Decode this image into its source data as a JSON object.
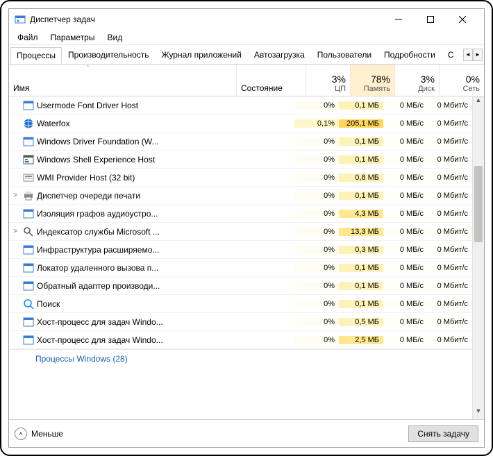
{
  "window": {
    "title": "Диспетчер задач"
  },
  "menus": {
    "file": "Файл",
    "options": "Параметры",
    "view": "Вид"
  },
  "tabs": {
    "processes": "Процессы",
    "performance": "Производительность",
    "apphistory": "Журнал приложений",
    "startup": "Автозагрузка",
    "users": "Пользователи",
    "details": "Подробности",
    "services_trunc": "С"
  },
  "columns": {
    "name": "Имя",
    "state": "Состояние",
    "cpu_pct": "3%",
    "cpu_label": "ЦП",
    "mem_pct": "78%",
    "mem_label": "Память",
    "disk_pct": "3%",
    "disk_label": "Диск",
    "net_pct": "0%",
    "net_label": "Сеть"
  },
  "rows": [
    {
      "icon": "window",
      "expand": "",
      "name": "Usermode Font Driver Host",
      "cpu": "0%",
      "mem": "0,1 МБ",
      "disk": "0 МБ/с",
      "net": "0 Мбит/с",
      "mcls": "mem-a",
      "ccls": "cpu0"
    },
    {
      "icon": "globe",
      "expand": "",
      "name": "Waterfox",
      "cpu": "0,1%",
      "mem": "205,1 МБ",
      "disk": "0 МБ/с",
      "net": "0 Мбит/с",
      "mcls": "mem-c",
      "ccls": "cpu1"
    },
    {
      "icon": "window",
      "expand": "",
      "name": "Windows Driver Foundation (W...",
      "cpu": "0%",
      "mem": "0,1 МБ",
      "disk": "0 МБ/с",
      "net": "0 Мбит/с",
      "mcls": "mem-a",
      "ccls": "cpu0"
    },
    {
      "icon": "shell",
      "expand": "",
      "name": "Windows Shell Experience Host",
      "cpu": "0%",
      "mem": "0,1 МБ",
      "disk": "0 МБ/с",
      "net": "0 Мбит/с",
      "mcls": "mem-a",
      "ccls": "cpu0"
    },
    {
      "icon": "wmi",
      "expand": "",
      "name": "WMI Provider Host (32 bit)",
      "cpu": "0%",
      "mem": "0,8 МБ",
      "disk": "0 МБ/с",
      "net": "0 Мбит/с",
      "mcls": "mem-a",
      "ccls": "cpu0"
    },
    {
      "icon": "printer",
      "expand": ">",
      "name": "Диспетчер очереди печати",
      "cpu": "0%",
      "mem": "0,1 МБ",
      "disk": "0 МБ/с",
      "net": "0 Мбит/с",
      "mcls": "mem-a",
      "ccls": "cpu0"
    },
    {
      "icon": "window",
      "expand": "",
      "name": "Изоляция графов аудиоустро...",
      "cpu": "0%",
      "mem": "4,3 МБ",
      "disk": "0 МБ/с",
      "net": "0 Мбит/с",
      "mcls": "mem-b",
      "ccls": "cpu0"
    },
    {
      "icon": "search",
      "expand": ">",
      "name": "Индексатор службы Microsoft ...",
      "cpu": "0%",
      "mem": "13,3 МБ",
      "disk": "0 МБ/с",
      "net": "0 Мбит/с",
      "mcls": "mem-b",
      "ccls": "cpu0"
    },
    {
      "icon": "window",
      "expand": "",
      "name": "Инфраструктура расширяемо...",
      "cpu": "0%",
      "mem": "0,3 МБ",
      "disk": "0 МБ/с",
      "net": "0 Мбит/с",
      "mcls": "mem-a",
      "ccls": "cpu0"
    },
    {
      "icon": "window",
      "expand": "",
      "name": "Локатор удаленного вызова п...",
      "cpu": "0%",
      "mem": "0,1 МБ",
      "disk": "0 МБ/с",
      "net": "0 Мбит/с",
      "mcls": "mem-a",
      "ccls": "cpu0"
    },
    {
      "icon": "window",
      "expand": "",
      "name": "Обратный адаптер производи...",
      "cpu": "0%",
      "mem": "0,1 МБ",
      "disk": "0 МБ/с",
      "net": "0 Мбит/с",
      "mcls": "mem-a",
      "ccls": "cpu0"
    },
    {
      "icon": "lens",
      "expand": "",
      "name": "Поиск",
      "cpu": "0%",
      "mem": "0,1 МБ",
      "disk": "0 МБ/с",
      "net": "0 Мбит/с",
      "mcls": "mem-a",
      "ccls": "cpu0"
    },
    {
      "icon": "window",
      "expand": "",
      "name": "Хост-процесс для задач Windo...",
      "cpu": "0%",
      "mem": "0,5 МБ",
      "disk": "0 МБ/с",
      "net": "0 Мбит/с",
      "mcls": "mem-a",
      "ccls": "cpu0"
    },
    {
      "icon": "window",
      "expand": "",
      "name": "Хост-процесс для задач Windo...",
      "cpu": "0%",
      "mem": "2,5 МБ",
      "disk": "0 МБ/с",
      "net": "0 Мбит/с",
      "mcls": "mem-b",
      "ccls": "cpu0"
    }
  ],
  "section": "Процессы Windows (28)",
  "footer": {
    "less": "Меньше",
    "end_task": "Снять задачу"
  }
}
